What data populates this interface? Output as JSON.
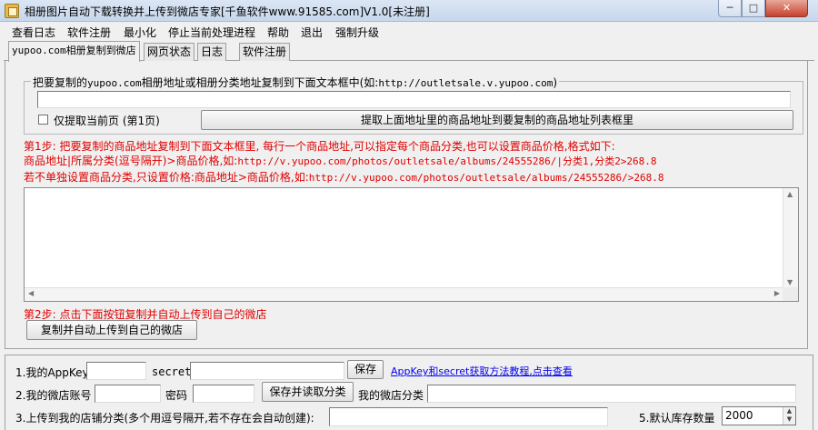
{
  "window": {
    "title": "相册图片自动下载转换并上传到微店专家[千鱼软件www.91585.com]V1.0[未注册]",
    "minimize": "─",
    "maximize": "□",
    "close": "✕"
  },
  "menu": [
    "查看日志",
    "软件注册",
    "最小化",
    "停止当前处理进程",
    "帮助",
    "退出",
    "强制升级"
  ],
  "tabs": [
    "yupoo.com相册复制到微店",
    "网页状态",
    "日志",
    "软件注册"
  ],
  "group": {
    "legend_prefix": "把要复制的",
    "legend_site": "yupoo.com",
    "legend_mid": "相册地址或相册分类地址复制到下面文本框中(如:",
    "legend_url": "http://outletsale.v.yupoo.com",
    "legend_suffix": ")",
    "url_value": "",
    "checkbox_label": "仅提取当前页 (第1页)",
    "checkbox_checked": false,
    "extract_button": "提取上面地址里的商品地址到要复制的商品地址列表框里"
  },
  "instructions": {
    "step1": "第1步:  把要复制的商品地址复制到下面文本框里,  每行一个商品地址,可以指定每个商品分类,也可以设置商品价格,格式如下:",
    "line2_prefix": "商品地址|所属分类(逗号隔开)>商品价格,如:",
    "line2_example": "http://v.yupoo.com/photos/outletsale/albums/24555286/|分类1,分类2>268.8",
    "line3_prefix": "若不单独设置商品分类,只设置价格:商品地址>商品价格,如:",
    "line3_example": "http://v.yupoo.com/photos/outletsale/albums/24555286/>268.8",
    "step2": "第2步:  点击下面按钮复制并自动上传到自己的微店"
  },
  "upload_button": "复制并自动上传到自己的微店",
  "bottom": {
    "appkey_label": "1.我的AppKey",
    "appkey_value": "",
    "secret_label": "secret",
    "secret_value": "",
    "save_button": "保存",
    "tutorial_link": "AppKey和secret获取方法教程,点击查看",
    "account_label": "2.我的微店账号",
    "account_value": "",
    "password_label": "密码",
    "password_value": "",
    "save_read_button": "保存并读取分类",
    "category_label": "我的微店分类",
    "category_value": "",
    "upload_category_label": "3.上传到我的店铺分类(多个用逗号隔开,若不存在会自动创建):",
    "upload_category_value": "",
    "stock_label": "5.默认库存数量",
    "stock_value": "2000"
  },
  "colors": {
    "instruction_red": "#e00000",
    "link_blue": "#0000ee"
  }
}
